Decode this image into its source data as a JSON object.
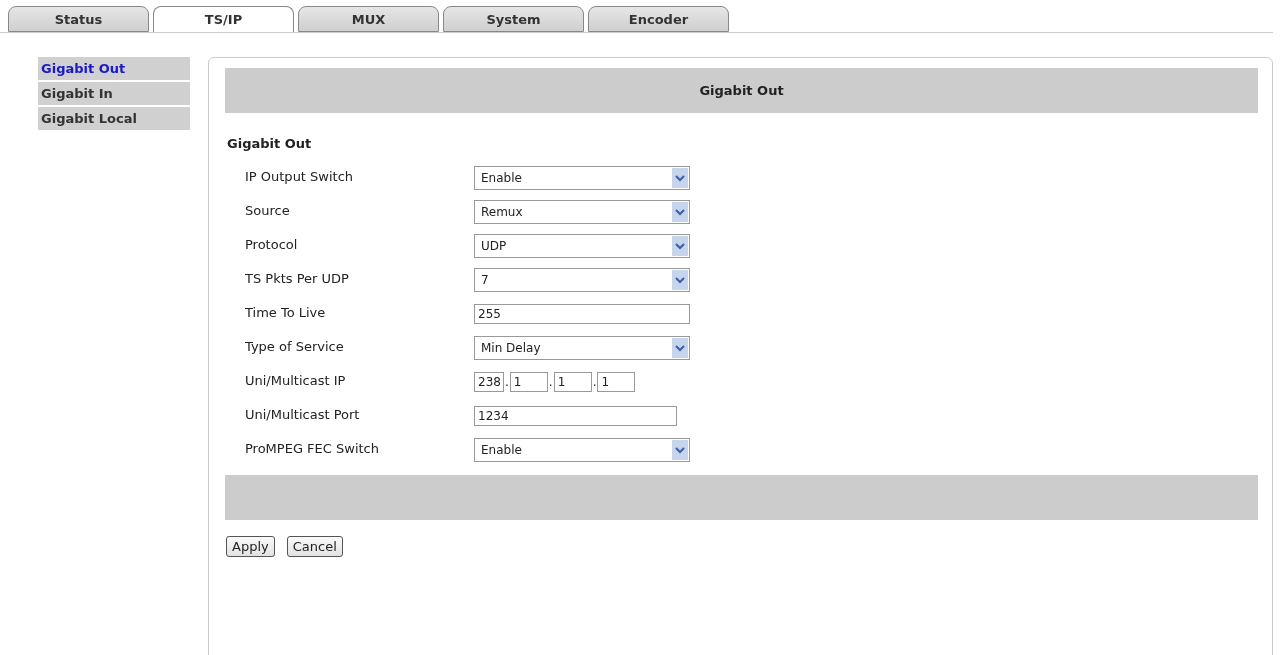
{
  "tabs": [
    {
      "label": "Status",
      "selected": false
    },
    {
      "label": "TS/IP",
      "selected": true
    },
    {
      "label": "MUX",
      "selected": false
    },
    {
      "label": "System",
      "selected": false
    },
    {
      "label": "Encoder",
      "selected": false
    }
  ],
  "sidebar": {
    "items": [
      {
        "label": "Gigabit Out",
        "selected": true
      },
      {
        "label": "Gigabit In",
        "selected": false
      },
      {
        "label": "Gigabit Local",
        "selected": false
      }
    ]
  },
  "panel": {
    "header": "Gigabit Out",
    "section_title": "Gigabit Out",
    "fields": [
      {
        "kind": "select",
        "label": "IP Output Switch",
        "value": "Enable"
      },
      {
        "kind": "select",
        "label": "Source",
        "value": "Remux"
      },
      {
        "kind": "select",
        "label": "Protocol",
        "value": "UDP"
      },
      {
        "kind": "select",
        "label": "TS Pkts Per UDP",
        "value": "7"
      },
      {
        "kind": "text",
        "label": "Time To Live",
        "value": "255"
      },
      {
        "kind": "select",
        "label": "Type of Service",
        "value": "Min Delay"
      },
      {
        "kind": "ip",
        "label": "Uni/Multicast IP",
        "octets": [
          "238",
          "1",
          "1",
          "1"
        ],
        "separators": [
          ".",
          ".",
          "."
        ]
      },
      {
        "kind": "text",
        "label": "Uni/Multicast Port",
        "value": "1234"
      },
      {
        "kind": "select",
        "label": "ProMPEG FEC Switch",
        "value": "Enable"
      }
    ],
    "buttons": [
      "Apply",
      "Cancel"
    ]
  }
}
